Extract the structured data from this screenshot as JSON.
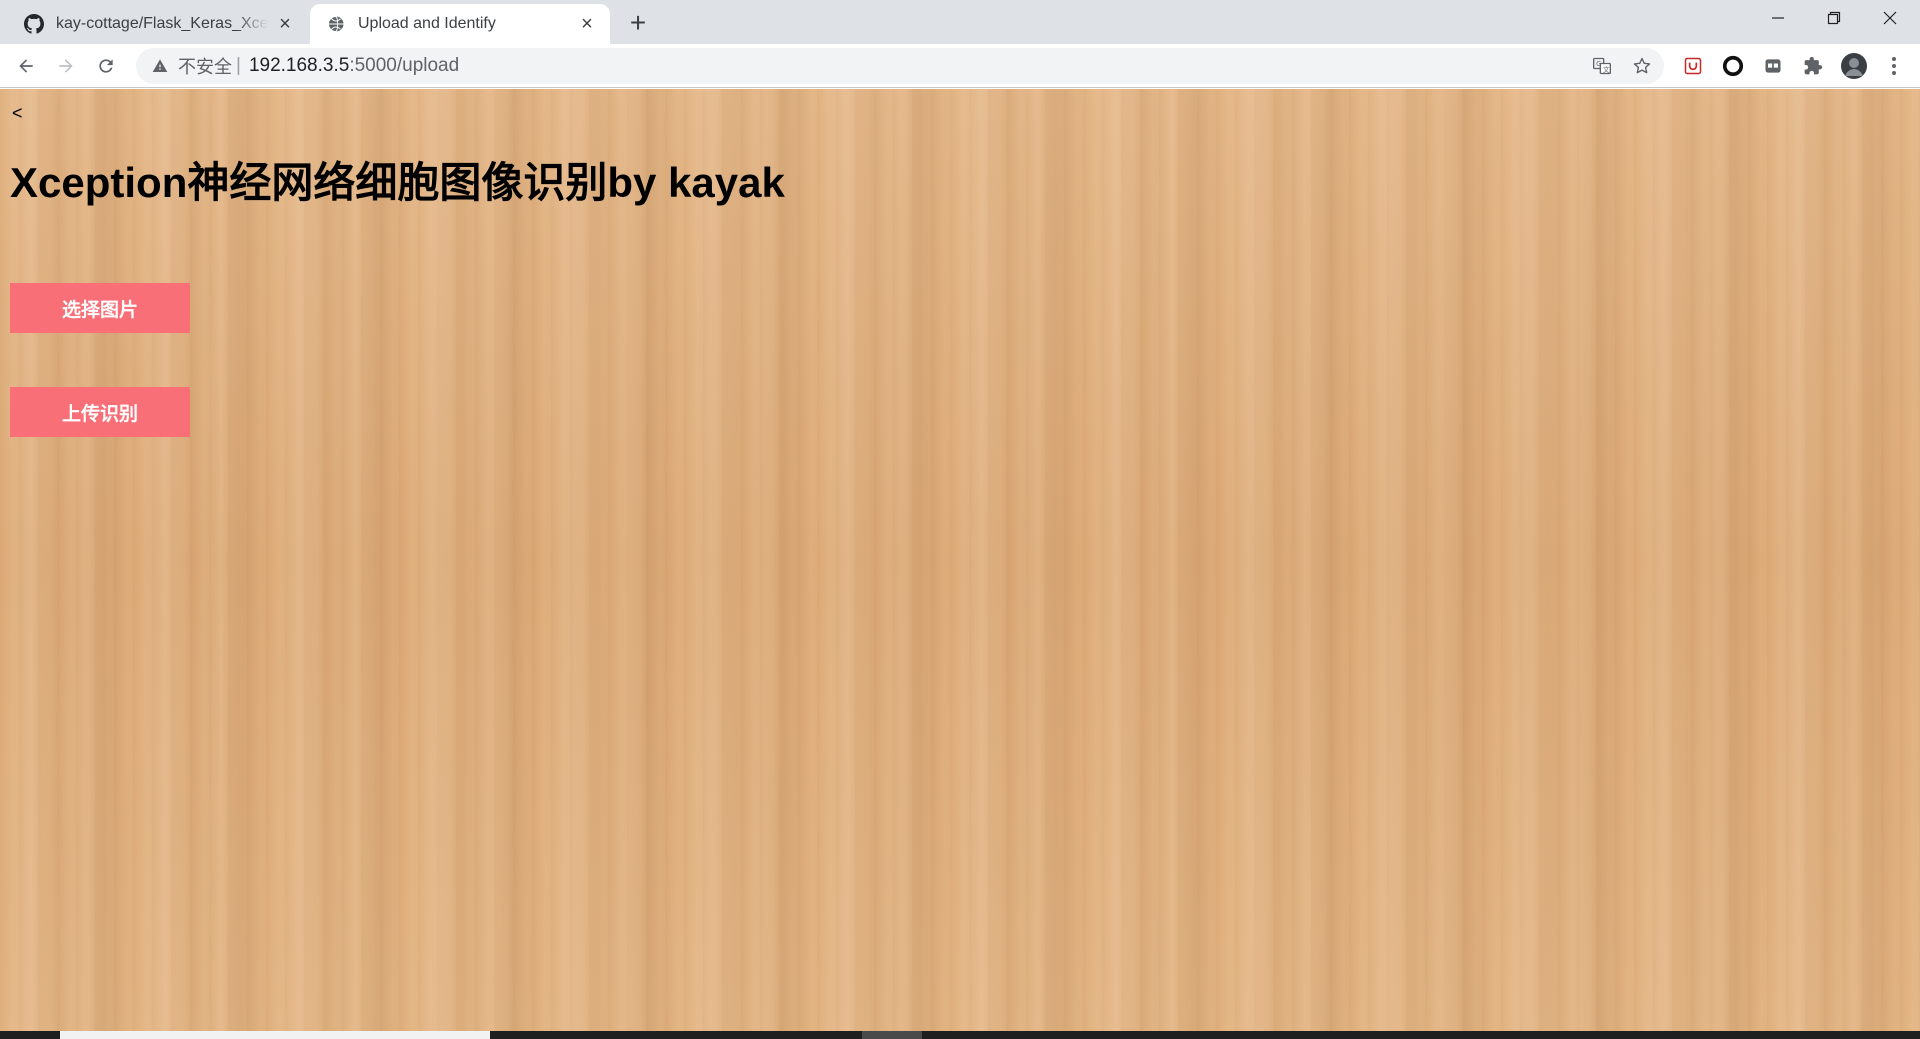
{
  "browser": {
    "tabs": [
      {
        "title": "kay-cottage/Flask_Keras_Xception",
        "favicon": "github-icon",
        "active": false
      },
      {
        "title": "Upload and Identify",
        "favicon": "globe-icon",
        "active": true
      }
    ],
    "new_tab_label": "+",
    "window_controls": {
      "minimize": "—",
      "restore": "❐",
      "close": "✕"
    },
    "address": {
      "security_label": "不安全",
      "separator": "|",
      "host": "192.168.3.5",
      "path": ":5000/upload"
    },
    "icons": [
      "back-icon",
      "forward-icon",
      "reload-icon",
      "warning-icon",
      "translate-icon",
      "bookmark-star-icon",
      "extension-shield-icon",
      "extension-circle-icon",
      "extension-box-icon",
      "puzzle-icon",
      "profile-avatar",
      "menu-kebab-icon"
    ]
  },
  "page": {
    "back_link": "<",
    "title": "Xception神经网络细胞图像识别by kayak",
    "select_button": "选择图片",
    "upload_button": "上传识别",
    "background": "wood-texture",
    "button_color": "#f96f77"
  }
}
